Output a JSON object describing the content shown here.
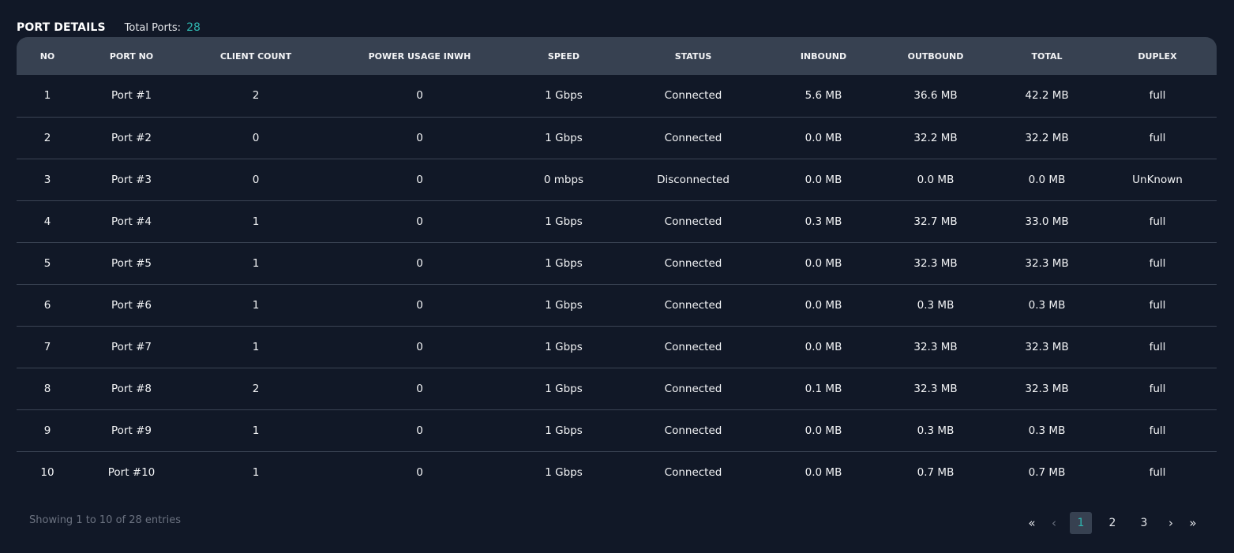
{
  "header": {
    "title": "PORT DETAILS",
    "total_label": "Total Ports:",
    "total_value": "28"
  },
  "table": {
    "columns": [
      "NO",
      "PORT NO",
      "CLIENT COUNT",
      "POWER USAGE INWH",
      "SPEED",
      "STATUS",
      "INBOUND",
      "OUTBOUND",
      "TOTAL",
      "DUPLEX"
    ],
    "rows": [
      [
        "1",
        "Port #1",
        "2",
        "0",
        "1 Gbps",
        "Connected",
        "5.6 MB",
        "36.6 MB",
        "42.2 MB",
        "full"
      ],
      [
        "2",
        "Port #2",
        "0",
        "0",
        "1 Gbps",
        "Connected",
        "0.0 MB",
        "32.2 MB",
        "32.2 MB",
        "full"
      ],
      [
        "3",
        "Port #3",
        "0",
        "0",
        "0 mbps",
        "Disconnected",
        "0.0 MB",
        "0.0 MB",
        "0.0 MB",
        "UnKnown"
      ],
      [
        "4",
        "Port #4",
        "1",
        "0",
        "1 Gbps",
        "Connected",
        "0.3 MB",
        "32.7 MB",
        "33.0 MB",
        "full"
      ],
      [
        "5",
        "Port #5",
        "1",
        "0",
        "1 Gbps",
        "Connected",
        "0.0 MB",
        "32.3 MB",
        "32.3 MB",
        "full"
      ],
      [
        "6",
        "Port #6",
        "1",
        "0",
        "1 Gbps",
        "Connected",
        "0.0 MB",
        "0.3 MB",
        "0.3 MB",
        "full"
      ],
      [
        "7",
        "Port #7",
        "1",
        "0",
        "1 Gbps",
        "Connected",
        "0.0 MB",
        "32.3 MB",
        "32.3 MB",
        "full"
      ],
      [
        "8",
        "Port #8",
        "2",
        "0",
        "1 Gbps",
        "Connected",
        "0.1 MB",
        "32.3 MB",
        "32.3 MB",
        "full"
      ],
      [
        "9",
        "Port #9",
        "1",
        "0",
        "1 Gbps",
        "Connected",
        "0.0 MB",
        "0.3 MB",
        "0.3 MB",
        "full"
      ],
      [
        "10",
        "Port #10",
        "1",
        "0",
        "1 Gbps",
        "Connected",
        "0.0 MB",
        "0.7 MB",
        "0.7 MB",
        "full"
      ]
    ]
  },
  "footer": {
    "info": "Showing 1 to 10 of 28 entries"
  },
  "pagination": {
    "first_icon": "double-chevron-left-icon",
    "prev_icon": "chevron-left-icon",
    "next_icon": "chevron-right-icon",
    "last_icon": "double-chevron-right-icon",
    "first_glyph": "«",
    "prev_glyph": "‹",
    "next_glyph": "›",
    "last_glyph": "»",
    "pages": [
      "1",
      "2",
      "3"
    ],
    "active_page": "1"
  },
  "colors": {
    "background": "#111827",
    "header_bg": "#374151",
    "accent": "#2fb7b0",
    "muted": "#6b7280"
  }
}
